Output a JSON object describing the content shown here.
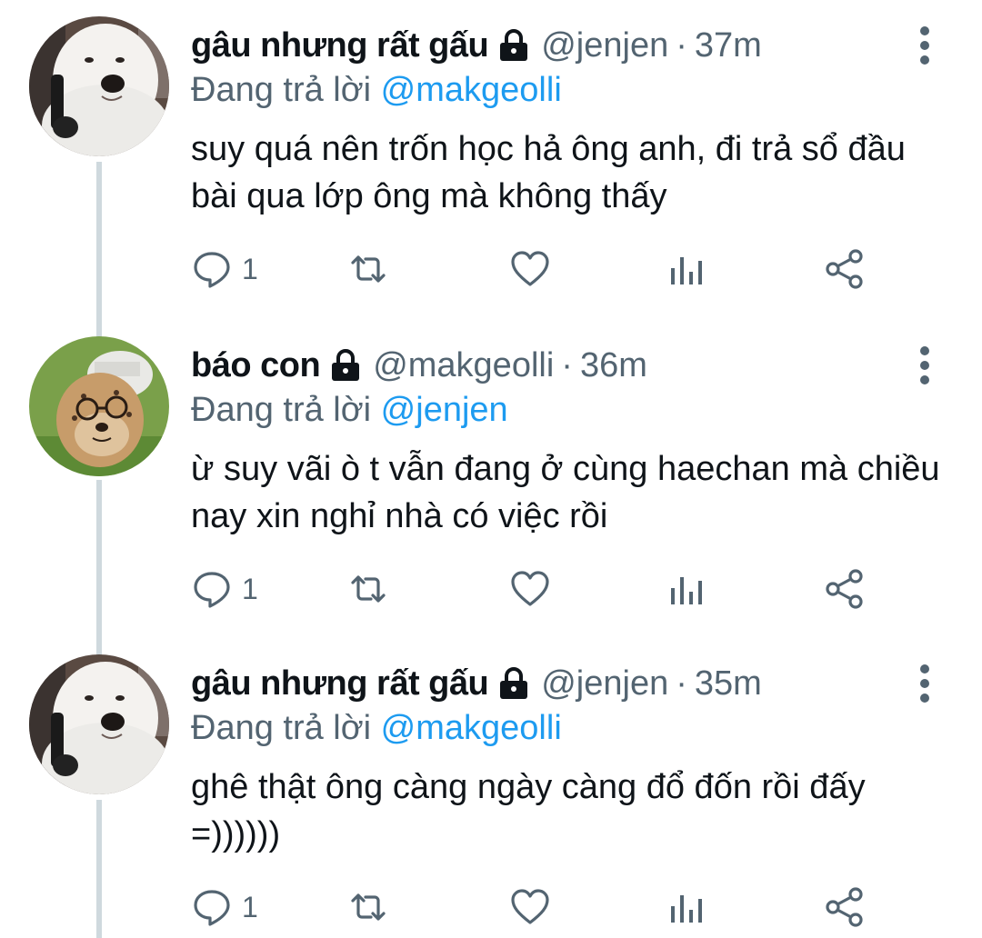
{
  "colors": {
    "name": "#0f1419",
    "secondary": "#536471",
    "accent": "#1d9bf0",
    "thread_line": "#cfd9de"
  },
  "tweets": [
    {
      "name": "gâu nhưng rất gấu",
      "handle": "@jenjen",
      "separator": "·",
      "time": "37m",
      "replying_prefix": "Đang trả lời",
      "replying_to": "@makgeolli",
      "text": "suy quá nên trốn học hả ông anh, đi trả sổ đầu bài qua lớp ông mà không thấy",
      "reply_count": "1",
      "avatar_icon": "samoyed-dog-avatar",
      "locked": true
    },
    {
      "name": "báo con",
      "handle": "@makgeolli",
      "separator": "·",
      "time": "36m",
      "replying_prefix": "Đang trả lời",
      "replying_to": "@jenjen",
      "text": "ừ suy vãi ò t vẫn đang ở cùng haechan mà chiều nay xin nghỉ nhà có việc rồi",
      "reply_count": "1",
      "avatar_icon": "cheetah-cub-avatar",
      "locked": true
    },
    {
      "name": "gâu nhưng rất gấu",
      "handle": "@jenjen",
      "separator": "·",
      "time": "35m",
      "replying_prefix": "Đang trả lời",
      "replying_to": "@makgeolli",
      "text": "ghê thật ông càng ngày càng đổ đốn rồi đấy =))))))",
      "reply_count": "1",
      "avatar_icon": "samoyed-dog-avatar",
      "locked": true
    }
  ]
}
